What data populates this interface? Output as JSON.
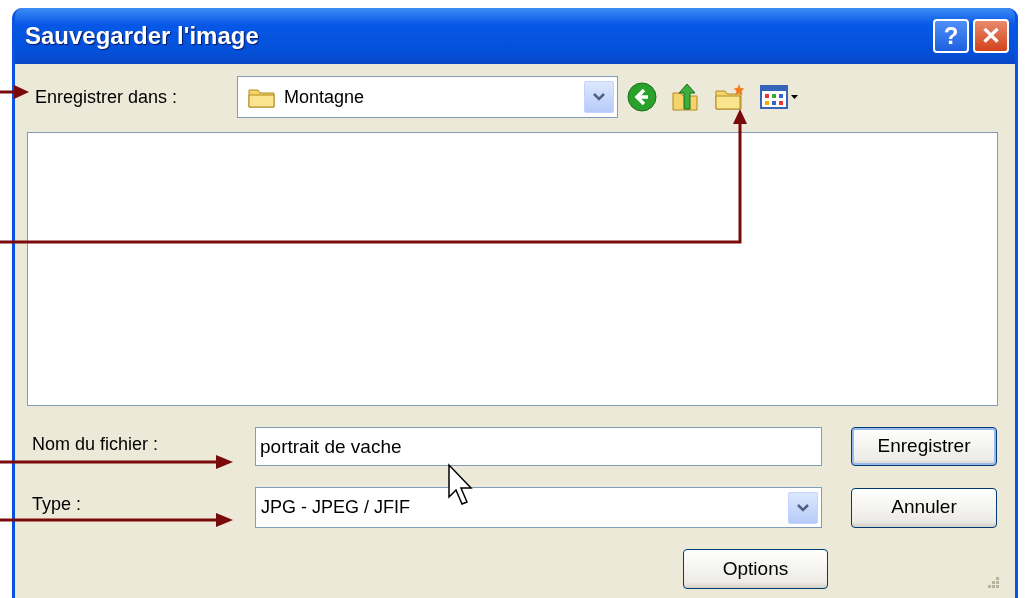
{
  "window": {
    "title": "Sauvegarder l'image"
  },
  "title_buttons": [
    {
      "kind": "help",
      "label": "?"
    },
    {
      "kind": "close",
      "label": "✕"
    }
  ],
  "save_in": {
    "label": "Enregistrer dans :",
    "value": "Montagne"
  },
  "file_name": {
    "label": "Nom du fichier :",
    "value": "portrait de vache"
  },
  "file_type": {
    "label": "Type :",
    "value": "JPG - JPEG / JFIF"
  },
  "buttons": [
    {
      "label": "Enregistrer",
      "default": true
    },
    {
      "label": "Annuler",
      "default": false
    },
    {
      "label": "Options",
      "default": false
    }
  ]
}
